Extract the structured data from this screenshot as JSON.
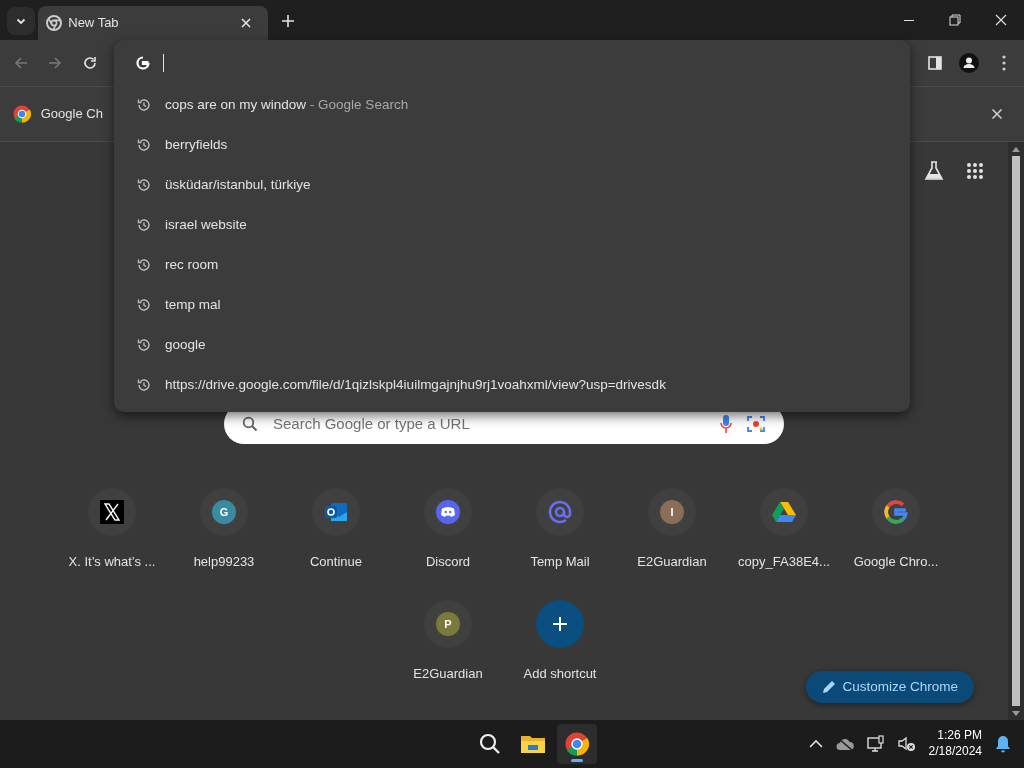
{
  "tabs": [
    {
      "title": "New Tab",
      "selected": true
    }
  ],
  "infobar": {
    "text": "Google Ch"
  },
  "omnibox": {
    "focused": true
  },
  "suggestions": [
    {
      "text": "cops are on my window",
      "detail": "- Google Search"
    },
    {
      "text": "berryfields"
    },
    {
      "text": "üsküdar/istanbul, türkiye"
    },
    {
      "text": "israel website"
    },
    {
      "text": "rec room"
    },
    {
      "text": "temp mal"
    },
    {
      "text": "google"
    },
    {
      "text": "https://drive.google.com/file/d/1qizlskpl4iuilmgajnjhu9rj1voahxml/view?usp=drivesdk"
    }
  ],
  "search": {
    "placeholder": "Search Google or type a URL"
  },
  "shortcuts": [
    {
      "title": "X. It’s what’s ...",
      "kind": "x"
    },
    {
      "title": "help99233",
      "kind": "letter",
      "letter": "G",
      "color": "#3a8aa0"
    },
    {
      "title": "Continue",
      "kind": "outlook"
    },
    {
      "title": "Discord",
      "kind": "discord"
    },
    {
      "title": "Temp Mail",
      "kind": "at"
    },
    {
      "title": "E2Guardian",
      "kind": "letter",
      "letter": "I",
      "color": "#8a6e5a"
    },
    {
      "title": "copy_FA38E4...",
      "kind": "drive"
    },
    {
      "title": "Google Chro...",
      "kind": "google"
    },
    {
      "title": "E2Guardian",
      "kind": "letter",
      "letter": "P",
      "color": "#7a7a3a"
    },
    {
      "title": "Add shortcut",
      "kind": "add"
    }
  ],
  "customize": {
    "label": "Customize Chrome"
  },
  "taskbar": {
    "apps": [
      {
        "kind": "search",
        "selected": false
      },
      {
        "kind": "folder",
        "selected": false
      },
      {
        "kind": "chrome",
        "selected": true
      }
    ],
    "time": "1:26 PM",
    "date": "2/18/2024"
  }
}
